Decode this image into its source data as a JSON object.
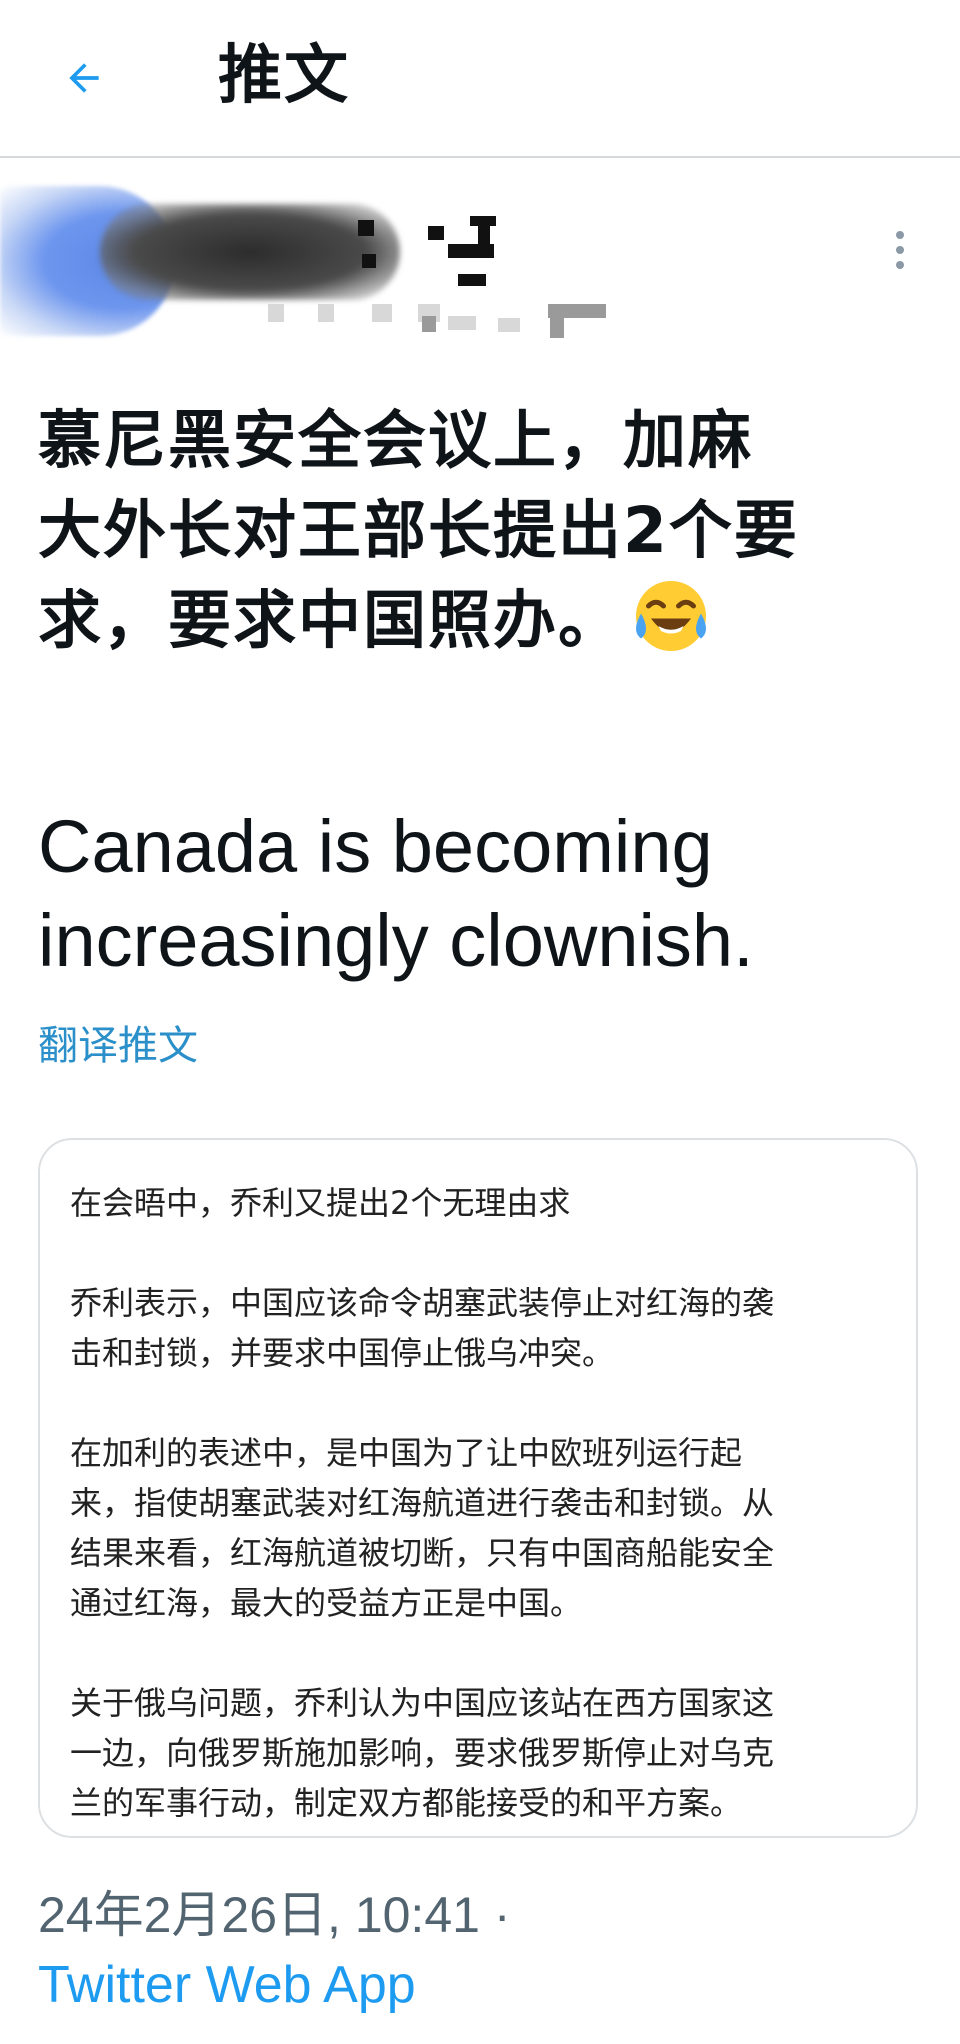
{
  "header": {
    "title": "推文",
    "back_icon": "arrow-left-icon",
    "accent_color": "#1d9bf0"
  },
  "author": {
    "name_redacted": true,
    "more_icon": "more-vertical-icon"
  },
  "tweet": {
    "text_cn_line1": "慕尼黑安全会议上，加麻",
    "text_cn_line2": "大外长对王部长提出2个要",
    "text_cn_line3": "求，要求中国照办。",
    "emoji": "face-with-tears-of-joy-icon",
    "text_en_line1": "Canada is becoming",
    "text_en_line2": "increasingly clownish.",
    "translate_label": "翻译推文"
  },
  "quote": {
    "p1": "在会晤中，乔利又提出2个无理由求",
    "p2_l1": "乔利表示，中国应该命令胡塞武装停止对红海的袭",
    "p2_l2": "击和封锁，并要求中国停止俄乌冲突。",
    "p3_l1": "在加利的表述中，是中国为了让中欧班列运行起",
    "p3_l2": "来，指使胡塞武装对红海航道进行袭击和封锁。从",
    "p3_l3": "结果来看，红海航道被切断，只有中国商船能安全",
    "p3_l4": "通过红海，最大的受益方正是中国。",
    "p4_l1": "关于俄乌问题，乔利认为中国应该站在西方国家这",
    "p4_l2": "一边，向俄罗斯施加影响，要求俄罗斯停止对乌克",
    "p4_l3": "兰的军事行动，制定双方都能接受的和平方案。"
  },
  "meta": {
    "timestamp": "24年2月26日, 10:41 ·",
    "source": "Twitter Web App"
  }
}
